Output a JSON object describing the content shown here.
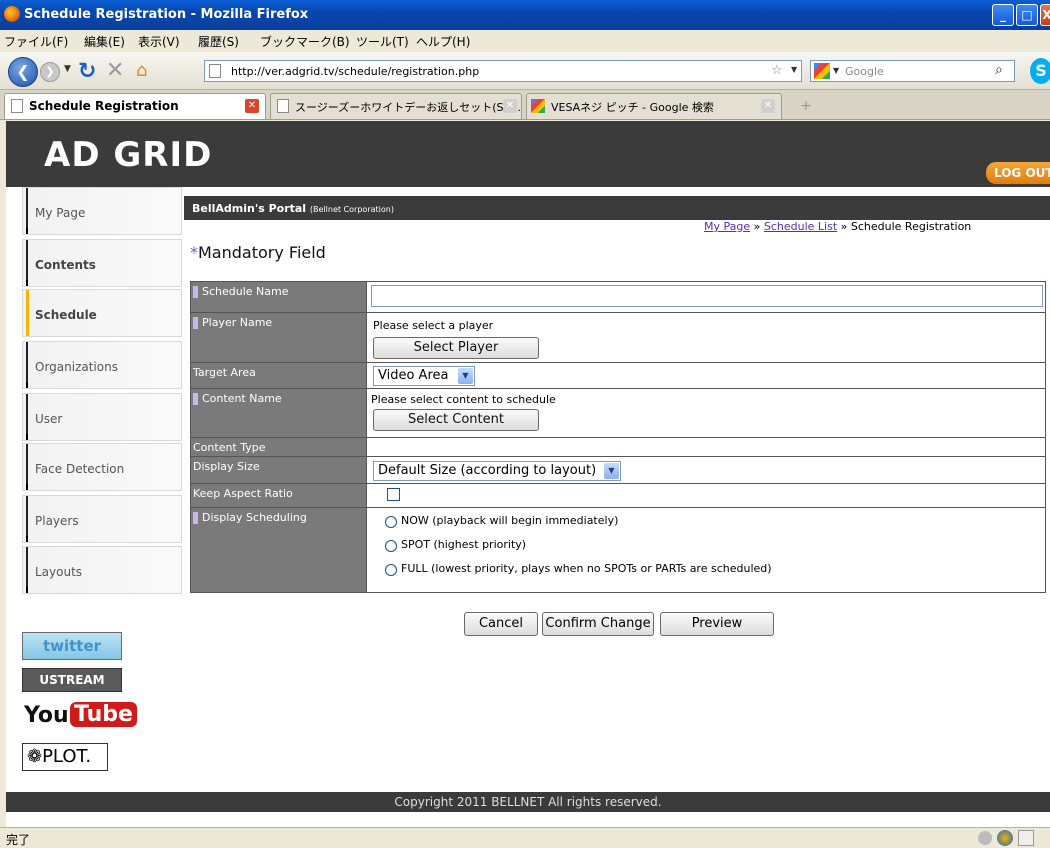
{
  "window": {
    "title": "Schedule Registration - Mozilla Firefox",
    "minimize": "_",
    "maximize": "□",
    "close": "X"
  },
  "menu": [
    "ファイル(F)",
    "編集(E)",
    "表示(V)",
    "履歴(S)",
    "ブックマーク(B)",
    "ツール(T)",
    "ヘルプ(H)"
  ],
  "nav": {
    "url": "http://ver.adgrid.tv/schedule/registration.php",
    "search_placeholder": "Google"
  },
  "tabs": [
    {
      "label": "Schedule Registration",
      "active": true
    },
    {
      "label": "スージーズーホワイトデーお返しセット(Su...",
      "active": false
    },
    {
      "label": "VESAネジ ピッチ - Google 検索",
      "active": false
    }
  ],
  "header": {
    "logo": "AD GRID",
    "logout": "LOG OUT"
  },
  "sidebar": {
    "items": [
      {
        "label": "My Page"
      },
      {
        "label": "Contents"
      },
      {
        "label": "Schedule"
      },
      {
        "label": "Organizations"
      },
      {
        "label": "User"
      },
      {
        "label": "Face Detection"
      },
      {
        "label": "Players"
      },
      {
        "label": "Layouts"
      }
    ]
  },
  "social": {
    "twitter": "twitter",
    "ustream": "USTREAM",
    "youtube_you": "You",
    "youtube_tube": "Tube",
    "plot": "❁PLOT."
  },
  "portal": {
    "title": "BellAdmin's Portal",
    "subtitle": "(Bellnet Corporation)"
  },
  "breadcrumb": {
    "link1": "My Page",
    "sep": "»",
    "link2": "Schedule List",
    "current": "Schedule Registration"
  },
  "mandatory": {
    "asterisk": "*",
    "label": "Mandatory Field"
  },
  "form": {
    "schedule_name_label": "Schedule Name",
    "schedule_name_value": "",
    "player_name_label": "Player Name",
    "player_hint": "Please select a player",
    "select_player": "Select Player",
    "target_area_label": "Target Area",
    "target_area_value": "Video Area",
    "content_name_label": "Content Name",
    "content_hint": "Please select content to schedule",
    "select_content": "Select Content",
    "content_type_label": "Content Type",
    "display_size_label": "Display Size",
    "display_size_value": "Default Size (according to layout)",
    "keep_aspect_label": "Keep Aspect Ratio",
    "keep_aspect_checked": false,
    "scheduling_label": "Display Scheduling",
    "scheduling_options": [
      "NOW (playback will begin immediately)",
      "SPOT (highest priority)",
      "FULL (lowest priority, plays when no SPOTs or PARTs are scheduled)"
    ]
  },
  "actions": {
    "cancel": "Cancel",
    "confirm": "Confirm Change",
    "preview": "Preview"
  },
  "footer": "Copyright 2011 BELLNET All rights reserved.",
  "status": "完了",
  "colors": {
    "accent_active": "#f6b400",
    "dark_bar": "#3b3b3b",
    "label_bg": "#7a7a7a",
    "logout": "#e07d0c",
    "link": "#5b2bb5"
  }
}
